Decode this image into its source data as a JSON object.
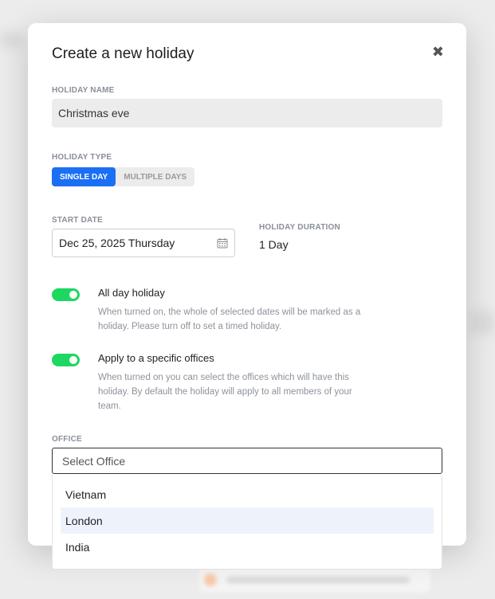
{
  "modal": {
    "title": "Create a new holiday",
    "close_glyph": "✖"
  },
  "holiday_name": {
    "label": "HOLIDAY NAME",
    "value": "Christmas eve"
  },
  "holiday_type": {
    "label": "HOLIDAY TYPE",
    "options": [
      "SINGLE DAY",
      "MULTIPLE DAYS"
    ],
    "selected": "SINGLE DAY",
    "active_color": "#1a6ff5"
  },
  "start_date": {
    "label": "START DATE",
    "value": "Dec 25, 2025 Thursday",
    "icon": "calendar-icon"
  },
  "duration": {
    "label": "HOLIDAY DURATION",
    "value": "1 Day"
  },
  "all_day": {
    "title": "All day holiday",
    "description": "When turned on, the whole of selected dates will be marked as a holiday. Please turn off to set a timed holiday.",
    "enabled": true
  },
  "specific_offices": {
    "title": "Apply to a specific offices",
    "description": "When turned on you can select the offices which will have this holiday. By default the holiday will apply to all members of your team.",
    "enabled": true
  },
  "toggle_color": "#1ed760",
  "office": {
    "label": "OFFICE",
    "placeholder": "Select Office",
    "options": [
      "Vietnam",
      "London",
      "India"
    ],
    "highlighted": "London"
  }
}
